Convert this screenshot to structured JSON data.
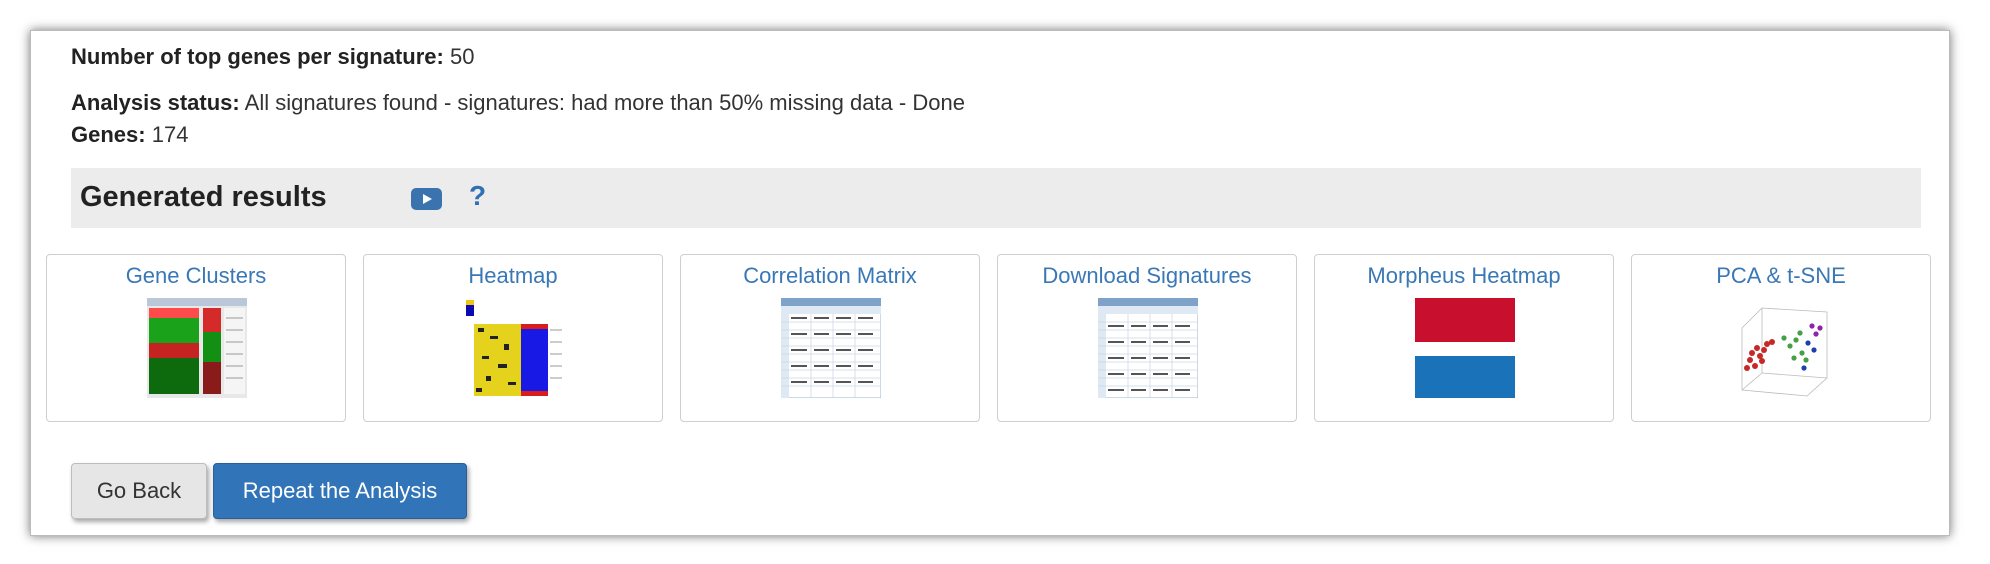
{
  "summary": {
    "top_genes_label": "Number of top genes per signature:",
    "top_genes_value": "50",
    "status_label": "Analysis status:",
    "status_value": "All signatures found - signatures: had more than 50% missing data - Done",
    "genes_label": "Genes:",
    "genes_value": "174"
  },
  "results": {
    "title": "Generated results",
    "help_glyph": "?",
    "icons": [
      "youtube-icon",
      "help-icon"
    ],
    "cards": [
      {
        "label": "Gene Clusters",
        "thumb": "gene-clusters-thumbnail"
      },
      {
        "label": "Heatmap",
        "thumb": "heatmap-thumbnail"
      },
      {
        "label": "Correlation Matrix",
        "thumb": "correlation-matrix-thumbnail"
      },
      {
        "label": "Download Signatures",
        "thumb": "download-signatures-thumbnail"
      },
      {
        "label": "Morpheus Heatmap",
        "thumb": "morpheus-heatmap-thumbnail"
      },
      {
        "label": "PCA & t-SNE",
        "thumb": "pca-tsne-thumbnail"
      }
    ]
  },
  "buttons": {
    "back_label": "Go Back",
    "repeat_label": "Repeat the Analysis"
  },
  "colors": {
    "accent": "#3274b8",
    "link": "#3a78b5",
    "morpheus_red": "#c8102e",
    "morpheus_blue": "#1a72b8"
  }
}
